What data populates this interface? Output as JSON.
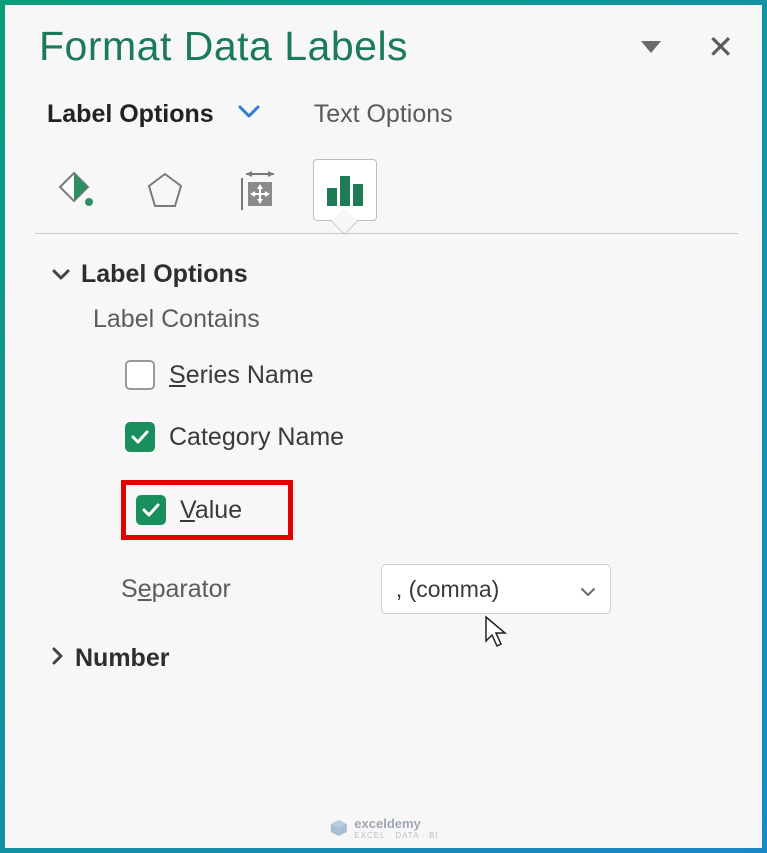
{
  "panel": {
    "title": "Format Data Labels"
  },
  "tabs": {
    "label_options": "Label Options",
    "text_options": "Text Options"
  },
  "section": {
    "label_options": "Label Options",
    "label_contains": "Label Contains",
    "number": "Number"
  },
  "checks": {
    "series_name": "eries Name",
    "series_name_u": "S",
    "category_name_a": "Cate",
    "category_name_u": "g",
    "category_name_b": "ory Name",
    "value_u": "V",
    "value_rest": "alue"
  },
  "separator": {
    "label_a": "S",
    "label_u": "e",
    "label_b": "parator",
    "value": ", (comma)"
  },
  "watermark": {
    "brand": "exceldemy",
    "tag": "EXCEL · DATA · BI"
  }
}
